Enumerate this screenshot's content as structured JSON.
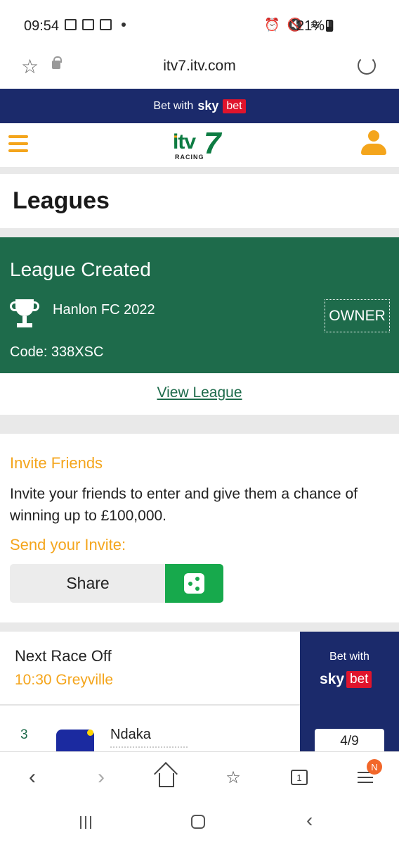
{
  "status_bar": {
    "time": "09:54",
    "battery": "21%"
  },
  "browser": {
    "url": "itv7.itv.com"
  },
  "banner": {
    "bet_with": "Bet with",
    "sky": "sky",
    "bet": "bet"
  },
  "page": {
    "title": "Leagues"
  },
  "league_card": {
    "heading": "League Created",
    "name": "Hanlon FC 2022",
    "role": "OWNER",
    "code": "Code: 338XSC"
  },
  "view_league": "View League",
  "invite": {
    "title": "Invite Friends",
    "text": "Invite your friends to enter and give them a chance of winning up to £100,000.",
    "send_title": "Send your Invite:",
    "share_label": "Share"
  },
  "next_race": {
    "label": "Next Race Off",
    "time_venue": "10:30 Greyville",
    "bet_with": "Bet with",
    "sky": "sky",
    "bet": "bet",
    "runner": {
      "number": "3",
      "name": "Ndaka",
      "odds": "4/9"
    }
  },
  "bottom_bar": {
    "tabs_count": "1",
    "menu_badge": "N"
  },
  "colors": {
    "green": "#1e6b4b",
    "orange": "#f4a51c",
    "navy": "#1b2a6b",
    "bet_red": "#e0142c",
    "share_green": "#17a94c"
  }
}
